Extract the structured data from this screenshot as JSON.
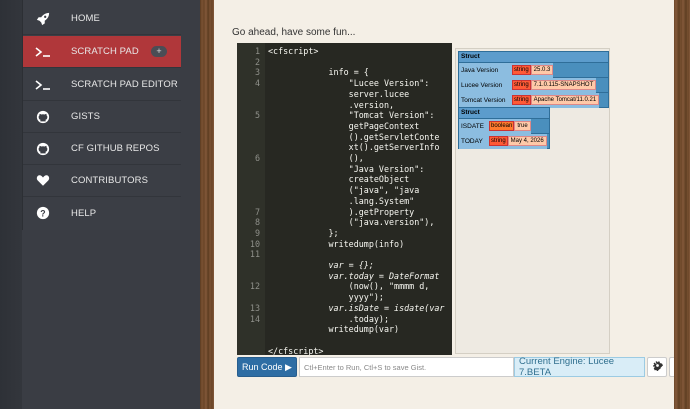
{
  "nav": {
    "items": [
      {
        "label": "HOME",
        "icon": "rocket-icon"
      },
      {
        "label": "SCRATCH PAD",
        "icon": "terminal-icon",
        "badge": "+",
        "active": true
      },
      {
        "label": "SCRATCH PAD EDITOR",
        "icon": "terminal-icon"
      },
      {
        "label": "GISTS",
        "icon": "github-icon"
      },
      {
        "label": "CF GITHUB REPOS",
        "icon": "github-icon"
      },
      {
        "label": "CONTRIBUTORS",
        "icon": "heart-icon"
      },
      {
        "label": "HELP",
        "icon": "question-icon"
      }
    ]
  },
  "main": {
    "intro": "Go ahead, have some fun..."
  },
  "editor": {
    "line_numbers": [
      "1",
      "2",
      "3",
      "4",
      "",
      "",
      "5",
      "",
      "",
      "",
      "6",
      "",
      "",
      "",
      "",
      "7",
      "8",
      "9",
      "10",
      "11",
      "",
      "",
      "12",
      "",
      "13",
      "14"
    ],
    "lines": [
      "<cfscript>",
      "",
      "            info = {",
      "                \"Lucee Version\":",
      "                server.lucee",
      "                .version,",
      "                \"Tomcat Version\":",
      "                getPageContext",
      "                ().getServletConte",
      "                xt().getServerInfo",
      "                (),",
      "                \"Java Version\":",
      "                createObject",
      "                (\"java\", \"java",
      "                .lang.System\"",
      "                ).getProperty",
      "                (\"java.version\"),",
      "            };",
      "            writedump(info)",
      "",
      "            var = {};",
      "            var.today = DateFormat",
      "                (now(), \"mmmm d,",
      "                yyyy\");",
      "            var.isDate = isdate(var",
      "                .today);",
      "            writedump(var)",
      "",
      "</cfscript>"
    ]
  },
  "output": {
    "struct1": {
      "header": "Struct",
      "rows": [
        {
          "key": "Java Version",
          "type": "string",
          "value": "25.0.3"
        },
        {
          "key": "Lucee Version",
          "type": "string",
          "value": "7.1.0.115-SNAPSHOT"
        },
        {
          "key": "Tomcat Version",
          "type": "string",
          "value": "Apache Tomcat/11.0.21"
        }
      ]
    },
    "struct2": {
      "header": "Struct",
      "rows": [
        {
          "key": "ISDATE",
          "type": "boolean",
          "value": "true"
        },
        {
          "key": "TODAY",
          "type": "string",
          "value": "May 4, 2026"
        }
      ]
    }
  },
  "toolbar": {
    "run_label": "Run Code ▶",
    "hint": "Ctl+Enter to Run, Ctl+S to save Gist.",
    "engine": "Current Engine: Lucee 7.BETA"
  },
  "colors": {
    "active_nav": "#b0373a",
    "run_button": "#2e6da4",
    "engine_bg": "#d9edf7"
  }
}
